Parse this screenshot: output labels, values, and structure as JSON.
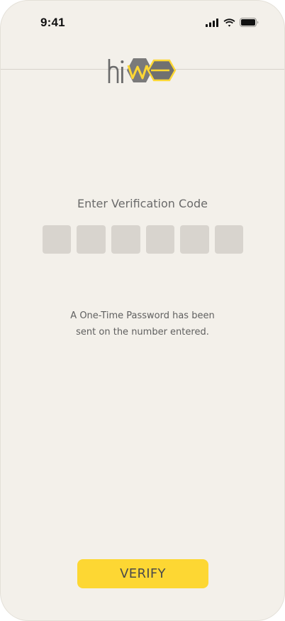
{
  "status_bar": {
    "time": "9:41",
    "icons": [
      "signal-icon",
      "wifi-icon",
      "battery-icon"
    ]
  },
  "header": {
    "logo_text": "hiwe"
  },
  "verification": {
    "title": "Enter Verification Code",
    "code_length": 6,
    "digits": [
      "",
      "",
      "",
      "",
      "",
      ""
    ],
    "message_line1": "A One-Time Password has been",
    "message_line2": "sent on the number entered."
  },
  "actions": {
    "verify_label": "VERIFY"
  },
  "colors": {
    "background": "#f3f0ea",
    "otp_box": "#d8d4ce",
    "accent": "#fdd733",
    "logo_gray": "#6b6b6b",
    "text": "#6a6a6a"
  }
}
